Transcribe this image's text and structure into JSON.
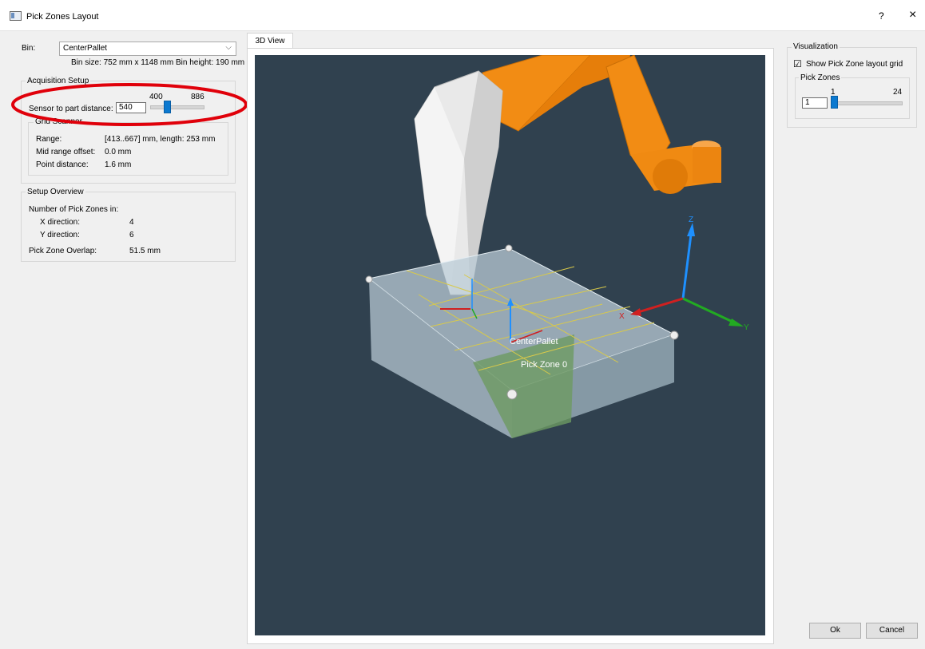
{
  "window": {
    "title": "Pick Zones Layout",
    "help": "?",
    "close": "×"
  },
  "bin": {
    "label": "Bin:",
    "selected": "CenterPallet",
    "info": "Bin size: 752 mm x 1148 mm  Bin height: 190 mm"
  },
  "acquisition": {
    "title": "Acquisition Setup",
    "sensor_label": "Sensor to part distance:",
    "sensor_value": "540",
    "slider_min": "400",
    "slider_max": "886",
    "slider_fraction": 0.29,
    "grid": {
      "title": "Grid Scanner",
      "rows": [
        {
          "label": "Range:",
          "value": "[413..667] mm, length: 253 mm"
        },
        {
          "label": "Mid range offset:",
          "value": "0.0 mm"
        },
        {
          "label": "Point distance:",
          "value": "1.6 mm"
        }
      ]
    }
  },
  "overview": {
    "title": "Setup Overview",
    "heading": "Number of Pick Zones in:",
    "x_label": "X direction:",
    "x_value": "4",
    "y_label": "Y direction:",
    "y_value": "6",
    "overlap_label": "Pick Zone Overlap:",
    "overlap_value": "51.5 mm"
  },
  "view": {
    "tab": "3D View",
    "bin_label": "CenterPallet",
    "zone_label": "Pick Zone 0",
    "axis_z": "Z",
    "axis_x": "X",
    "axis_y": "Y"
  },
  "visualization": {
    "title": "Visualization",
    "show_grid_label": "Show Pick Zone layout grid",
    "show_grid_checked": true,
    "check_mark": "☑",
    "zones_title": "Pick Zones",
    "zone_min": "1",
    "zone_max": "24",
    "zone_value": "1",
    "zone_fraction": 0.0
  },
  "buttons": {
    "ok": "Ok",
    "cancel": "Cancel"
  },
  "colors": {
    "accent": "#0b79d0",
    "viewport_bg": "#30414f",
    "robot": "#f28c14",
    "annotation": "#e0000a"
  }
}
